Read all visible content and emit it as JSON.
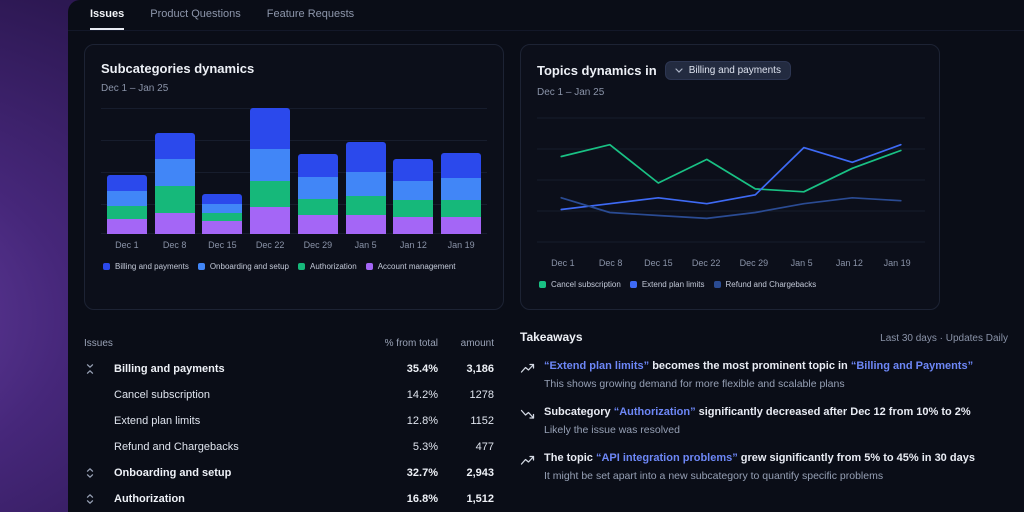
{
  "tabs": {
    "items": [
      {
        "label": "Issues",
        "active": true
      },
      {
        "label": "Product Questions",
        "active": false
      },
      {
        "label": "Feature Requests",
        "active": false
      }
    ]
  },
  "subcategories_card": {
    "title": "Subcategories dynamics",
    "date_range": "Dec 1 – Jan 25"
  },
  "topics_card": {
    "title": "Topics dynamics in",
    "selector_label": "Billing and payments",
    "date_range": "Dec 1 – Jan 25"
  },
  "chart_data": [
    {
      "type": "bar",
      "stacked": true,
      "title": "Subcategories dynamics",
      "categories": [
        "Dec 1",
        "Dec 8",
        "Dec 15",
        "Dec 22",
        "Dec 29",
        "Jan 5",
        "Jan 12",
        "Jan 19"
      ],
      "series": [
        {
          "name": "Billing and payments",
          "color": "#2b49ec",
          "values": [
            15,
            25,
            10,
            38,
            22,
            28,
            20,
            24
          ]
        },
        {
          "name": "Onboarding and setup",
          "color": "#4186f7",
          "values": [
            14,
            25,
            8,
            30,
            20,
            22,
            18,
            20
          ]
        },
        {
          "name": "Authorization",
          "color": "#16b87a",
          "values": [
            12,
            25,
            8,
            25,
            15,
            18,
            16,
            16
          ]
        },
        {
          "name": "Account management",
          "color": "#a466f6",
          "values": [
            14,
            20,
            12,
            25,
            18,
            18,
            16,
            16
          ]
        }
      ],
      "xlabel": "",
      "ylabel": "",
      "grid": true,
      "legend_position": "bottom"
    },
    {
      "type": "line",
      "title": "Topics dynamics in Billing and payments",
      "x": [
        "Dec 1",
        "Dec 8",
        "Dec 15",
        "Dec 22",
        "Dec 29",
        "Jan 5",
        "Jan 12",
        "Jan 19"
      ],
      "ylim": [
        0,
        80
      ],
      "series": [
        {
          "name": "Cancel subscription",
          "color": "#19c184",
          "values": [
            58,
            66,
            40,
            56,
            36,
            34,
            50,
            62
          ]
        },
        {
          "name": "Extend plan limits",
          "color": "#3e6af5",
          "values": [
            22,
            26,
            30,
            26,
            32,
            64,
            54,
            66
          ]
        },
        {
          "name": "Refund and Chargebacks",
          "color": "#2a4b93",
          "values": [
            30,
            20,
            18,
            16,
            20,
            26,
            30,
            28
          ]
        }
      ],
      "xlabel": "",
      "ylabel": "",
      "grid": true,
      "legend_position": "bottom"
    }
  ],
  "issues_table": {
    "title": "Issues",
    "columns": [
      "% from total",
      "amount"
    ],
    "rows": [
      {
        "name": "Billing and payments",
        "pct": "35.4%",
        "amount": "3,186",
        "level": 0,
        "icon": "collapse",
        "bold": true
      },
      {
        "name": "Cancel subscription",
        "pct": "14.2%",
        "amount": "1278",
        "level": 1,
        "icon": null,
        "bold": false
      },
      {
        "name": "Extend plan limits",
        "pct": "12.8%",
        "amount": "1152",
        "level": 1,
        "icon": null,
        "bold": false
      },
      {
        "name": "Refund and Chargebacks",
        "pct": "5.3%",
        "amount": "477",
        "level": 1,
        "icon": null,
        "bold": false
      },
      {
        "name": "Onboarding and setup",
        "pct": "32.7%",
        "amount": "2,943",
        "level": 0,
        "icon": "expand",
        "bold": true
      },
      {
        "name": "Authorization",
        "pct": "16.8%",
        "amount": "1,512",
        "level": 0,
        "icon": "expand",
        "bold": true
      }
    ]
  },
  "takeaways": {
    "title": "Takeaways",
    "meta": "Last 30 days · Updates Daily",
    "items": [
      {
        "trend": "up",
        "segments": [
          {
            "t": "“Extend plan limits”",
            "link": true
          },
          {
            "t": " becomes the most prominent topic in ",
            "link": false
          },
          {
            "t": "“Billing and Payments”",
            "link": true
          }
        ],
        "note": "This shows growing demand for more flexible and scalable plans"
      },
      {
        "trend": "down",
        "segments": [
          {
            "t": "Subcategory ",
            "link": false
          },
          {
            "t": "“Authorization”",
            "link": true
          },
          {
            "t": " significantly decreased after Dec 12 from 10% to 2%",
            "link": false
          }
        ],
        "note": "Likely the issue was resolved"
      },
      {
        "trend": "up",
        "segments": [
          {
            "t": "The topic ",
            "link": false
          },
          {
            "t": "“API integration problems”",
            "link": true
          },
          {
            "t": " grew significantly from 5% to 45% in 30 days",
            "link": false
          }
        ],
        "note": "It might be set apart into a new subcategory to quantify specific problems"
      }
    ]
  },
  "colors": {
    "panel_bg": "#0a0d17",
    "card_bg": "#0c0f1a",
    "accent_link": "#6d87f7",
    "background_purple": "#46277a"
  }
}
